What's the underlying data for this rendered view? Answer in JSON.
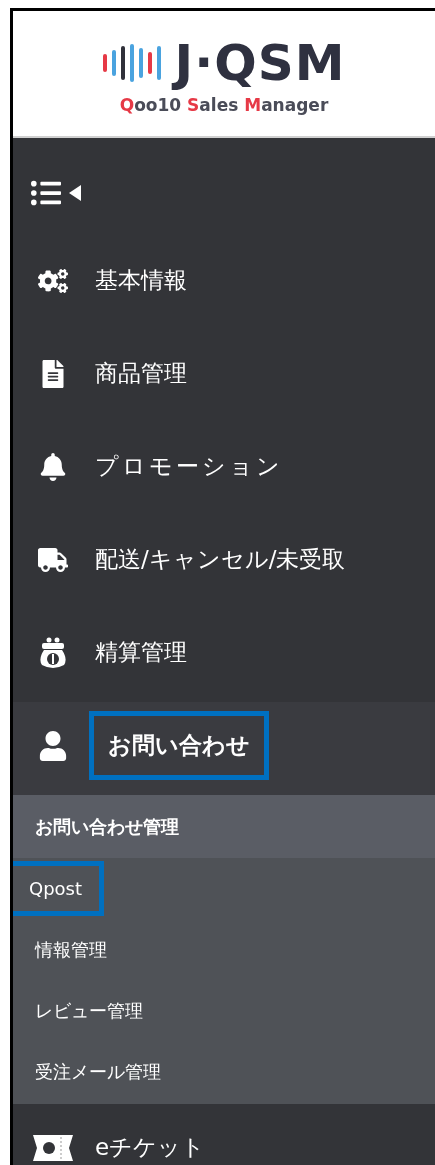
{
  "logo": {
    "wordmark": "J·QSM",
    "tagline": "Qoo10 Sales Manager"
  },
  "sidebar": {
    "collapsed": false,
    "items": [
      {
        "label": "基本情報",
        "expanded": false,
        "highlighted": false
      },
      {
        "label": "商品管理",
        "expanded": false,
        "highlighted": false
      },
      {
        "label": "プロモーション",
        "expanded": false,
        "highlighted": false
      },
      {
        "label": "配送/キャンセル/未受取",
        "expanded": false,
        "highlighted": false
      },
      {
        "label": "精算管理",
        "expanded": false,
        "highlighted": false
      },
      {
        "label": "お問い合わせ",
        "expanded": true,
        "highlighted": true,
        "submenu": {
          "title": "お問い合わせ管理",
          "children": [
            {
              "label": "Qpost",
              "highlighted": true
            },
            {
              "label": "情報管理",
              "highlighted": false
            },
            {
              "label": "レビュー管理",
              "highlighted": false
            },
            {
              "label": "受注メール管理",
              "highlighted": false
            }
          ]
        }
      },
      {
        "label": "eチケット",
        "expanded": false,
        "highlighted": false
      }
    ]
  }
}
